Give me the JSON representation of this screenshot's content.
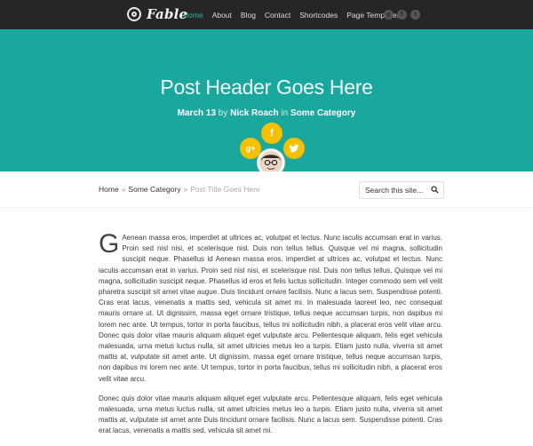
{
  "site": {
    "name": "Fable"
  },
  "nav": {
    "items": [
      {
        "label": "Home"
      },
      {
        "label": "About"
      },
      {
        "label": "Blog"
      },
      {
        "label": "Contact"
      },
      {
        "label": "Shortcodes"
      },
      {
        "label": "Page Templates"
      }
    ]
  },
  "social_top": {
    "items": [
      {
        "icon": "google-plus-icon",
        "glyph": "g"
      },
      {
        "icon": "facebook-icon",
        "glyph": "f"
      },
      {
        "icon": "twitter-icon",
        "glyph": "t"
      }
    ]
  },
  "hero": {
    "title": "Post Header Goes Here",
    "date": "March 13",
    "by": "by",
    "author": "Nick Roach",
    "in": "in",
    "category": "Some Category",
    "share": {
      "facebook": "f",
      "google": "g+",
      "twitter": "t"
    }
  },
  "breadcrumb": {
    "home": "Home",
    "sep": "»",
    "category": "Some Category",
    "current": "Post Title Goes Here"
  },
  "search": {
    "placeholder": "Search this site..."
  },
  "content": {
    "dropcap": "G",
    "paragraphs": [
      "Aenean massa eros, imperdiet at ultrices ac, volutpat et lectus. Nunc iaculis accumsan erat in varius. Proin sed nisl nisi, et scelerisque nisl. Duis non tellus tellus. Quisque vel mi magna, sollicitudin suscipit neque. Phasellus id Aenean massa eros, imperdiet at ultrices ac, volutpat et lectus. Nunc iaculis accumsan erat in varius. Proin sed nisl nisi, et scelerisque nisl. Duis non tellus tellus. Quisque vel mi magna, sollicitudin suscipit neque. Phasellus id eros et felis luctus sollicitudin. Integer commodo sem vel velit pharetra suscipit sit amet vitae augue. Duis tincidunt ornare facilisis. Nunc a lacus sem. Suspendisse potenti. Cras erat lacus, venenatis a mattis sed, vehicula sit amet mi. In malesuada laoreet leo, nec consequat mauris ornare ut. Ut dignissim, massa eget ornare tristique, tellus neque accumsan turpis, non dapibus mi lorem nec ante. Ut tempus, tortor in porta faucibus, tellus mi sollicitudin nibh, a placerat eros velit vitae arcu. Donec quis dolor vitae mauris aliquam aliquet eget vulputate arcu. Pellentesque aliquam, felis eget vehicula malesuada, urna metus luctus nulla, sit amet ultricies metus leo a turpis. Etiam justo nulla, viverra sit amet mattis at, vulputate sit amet ante. Ut dignissim, massa eget ornare tristique, tellus neque accumsan turpis, non dapibus mi lorem nec ante. Ut tempus, tortor in porta faucibus, tellus mi sollicitudin nibh, a placerat eros velit vitae arcu.",
      "Donec quis dolor vitae mauris aliquam aliquet eget vulputate arcu. Pellentesque aliquam, felis eget vehicula malesuada, urna metus luctus nulla, sit amet ultricies metus leo a turpis. Etiam justo nulla, viverra sit amet mattis at, vulputate sit amet ante Duis tincidunt ornare facilisis. Nunc a lacus sem. Suspendisse potenti. Cras erat lacus, venenatis a mattis sed, vehicula sit amet mi."
    ]
  }
}
